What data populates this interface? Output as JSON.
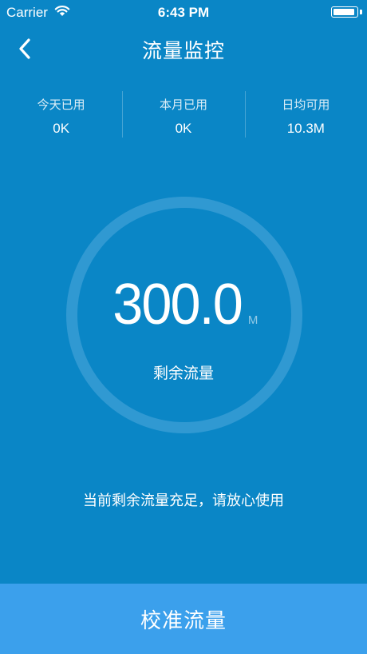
{
  "status_bar": {
    "carrier": "Carrier",
    "time": "6:43 PM",
    "wifi_icon": "wifi-icon",
    "battery_icon": "battery-icon"
  },
  "nav": {
    "back_icon": "chevron-left-icon",
    "title": "流量监控"
  },
  "stats": [
    {
      "label": "今天已用",
      "value": "0K"
    },
    {
      "label": "本月已用",
      "value": "0K"
    },
    {
      "label": "日均可用",
      "value": "10.3M"
    }
  ],
  "ring": {
    "value": "300.0",
    "unit": "M",
    "label": "剩余流量"
  },
  "message": "当前剩余流量充足，请放心使用",
  "calibrate_button": "校准流量",
  "colors": {
    "background": "#0a86c6",
    "button": "#3ba0ec",
    "ring": "#3d9fd6"
  }
}
